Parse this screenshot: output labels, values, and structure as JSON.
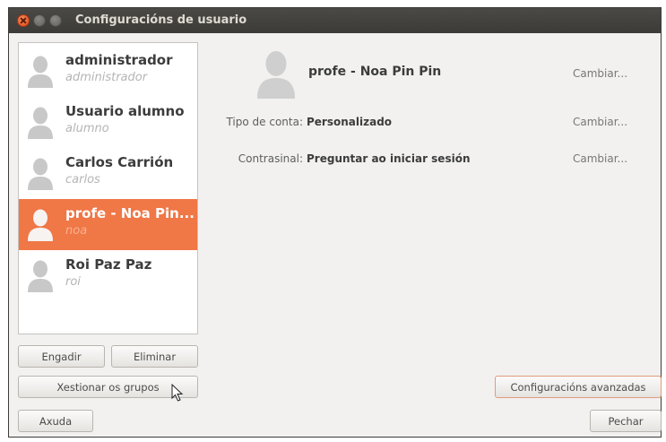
{
  "window": {
    "title": "Configuracións de usuario"
  },
  "users": [
    {
      "name": "administrador",
      "login": "administrador",
      "selected": false
    },
    {
      "name": "Usuario alumno",
      "login": "alumno",
      "selected": false
    },
    {
      "name": "Carlos Carrión",
      "login": "carlos",
      "selected": false
    },
    {
      "name": "profe - Noa Pin...",
      "login": "noa",
      "selected": true
    },
    {
      "name": "Roi Paz Paz",
      "login": "roi",
      "selected": false
    }
  ],
  "list_buttons": {
    "add": "Engadir",
    "remove": "Eliminar",
    "groups": "Xestionar os grupos"
  },
  "details": {
    "full_name": "profe - Noa Pin Pin",
    "account_type_label": "Tipo de conta:",
    "account_type_value": "Personalizado",
    "password_label": "Contrasinal:",
    "password_value": "Preguntar ao iniciar sesión",
    "change_link": "Cambiar..."
  },
  "footer": {
    "advanced": "Configuracións avanzadas",
    "help": "Axuda",
    "close": "Pechar"
  },
  "colors": {
    "selection": "#f07746",
    "titlebar": "#3c3b37",
    "close_button": "#df4a16"
  },
  "icons": [
    "close-icon",
    "minimize-icon",
    "maximize-icon",
    "user-avatar-icon",
    "mouse-cursor-icon"
  ]
}
